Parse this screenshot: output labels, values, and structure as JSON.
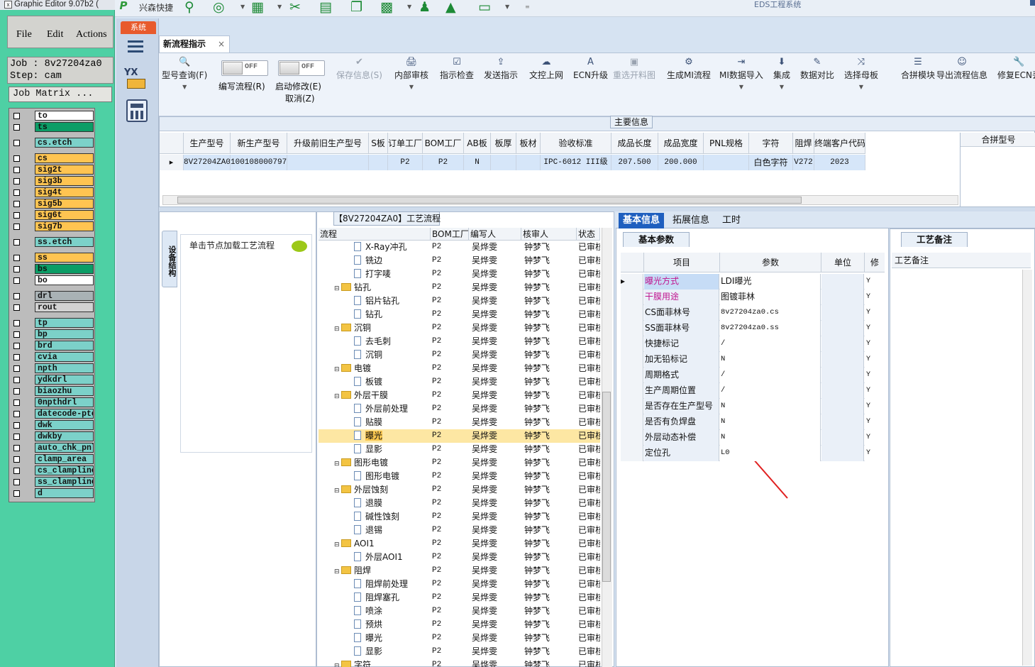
{
  "editor": {
    "title": "Graphic Editor 9.07b2 (",
    "menu": [
      "File",
      "Edit",
      "Actions"
    ],
    "job_line": "Job : 8v27204za0",
    "step_line": "Step: cam",
    "job_matrix": "Job Matrix ...",
    "layers": [
      {
        "name": "to",
        "color": "#ffffff"
      },
      {
        "name": "ts",
        "color": "#0c9d66"
      },
      {
        "name": "cs.etch",
        "color": "#7cd1c9"
      },
      {
        "name": "cs",
        "color": "#ffc451"
      },
      {
        "name": "sig2t",
        "color": "#ffc451"
      },
      {
        "name": "sig3b",
        "color": "#ffc451"
      },
      {
        "name": "sig4t",
        "color": "#ffc451"
      },
      {
        "name": "sig5b",
        "color": "#ffc451"
      },
      {
        "name": "sig6t",
        "color": "#ffc451"
      },
      {
        "name": "sig7b",
        "color": "#ffc451"
      },
      {
        "name": "ss.etch",
        "color": "#7cd1c9"
      },
      {
        "name": "ss",
        "color": "#ffc451"
      },
      {
        "name": "bs",
        "color": "#0c9d66"
      },
      {
        "name": "bo",
        "color": "#ffffff"
      },
      {
        "name": "drl",
        "color": "#a9b2b5"
      },
      {
        "name": "rout",
        "color": "#d2d2d2"
      },
      {
        "name": "tp",
        "color": "#7cd1c9"
      },
      {
        "name": "bp",
        "color": "#7cd1c9"
      },
      {
        "name": "brd",
        "color": "#7cd1c9"
      },
      {
        "name": "cvia",
        "color": "#7cd1c9"
      },
      {
        "name": "npth",
        "color": "#7cd1c9"
      },
      {
        "name": "ydkdrl",
        "color": "#7cd1c9"
      },
      {
        "name": "biaozhu",
        "color": "#7cd1c9"
      },
      {
        "name": "0npthdrl",
        "color": "#7cd1c9"
      },
      {
        "name": "datecode-pte",
        "color": "#7cd1c9"
      },
      {
        "name": "dwk",
        "color": "#7cd1c9"
      },
      {
        "name": "dwkby",
        "color": "#7cd1c9"
      },
      {
        "name": "auto_chk_pnl",
        "color": "#7cd1c9"
      },
      {
        "name": "clamp_area",
        "color": "#7cd1c9"
      },
      {
        "name": "cs_clampline",
        "color": "#7cd1c9"
      },
      {
        "name": "ss_clampline",
        "color": "#7cd1c9"
      },
      {
        "name": "d",
        "color": "#7cd1c9"
      }
    ]
  },
  "topbar": {
    "quick_label": "兴森快捷",
    "system_title": "EDS工程系统"
  },
  "leftnav": {
    "system_tab": "系统",
    "yx_label": "YX"
  },
  "doc_tab": {
    "label": "新流程指示",
    "close": "×"
  },
  "ribbon": {
    "toggle_text": "OFF",
    "buttons": [
      {
        "label": "型号查询(F)",
        "icon": "🔍"
      },
      {
        "label": "编写流程(R)"
      },
      {
        "label": "启动修改(E)",
        "label2": "取消(Z)"
      },
      {
        "label": "保存信息(S)",
        "icon": "✔",
        "disabled": true
      },
      {
        "label": "内部审核",
        "icon": "🖨"
      },
      {
        "label": "指示检查",
        "icon": "☑"
      },
      {
        "label": "发送指示",
        "icon": "⇪"
      },
      {
        "label": "文控上网",
        "icon": "☁"
      },
      {
        "label": "ECN升级",
        "icon": "A"
      },
      {
        "label": "重选开料图",
        "icon": "▣",
        "disabled": true
      },
      {
        "label": "生成MI流程",
        "icon": "⚙"
      },
      {
        "label": "MI数据导入",
        "icon": "⇥"
      },
      {
        "label": "集成",
        "icon": "⬇"
      },
      {
        "label": "数据对比",
        "icon": "✎"
      },
      {
        "label": "选择母板",
        "icon": "⤨"
      },
      {
        "label": "合拼模块",
        "icon": "☰"
      },
      {
        "label": "导出流程信息",
        "icon": "☺"
      },
      {
        "label": "修复ECN丢",
        "icon": "🔧"
      }
    ]
  },
  "main_info": {
    "title": "主要信息",
    "columns": [
      "生产型号",
      "新生产型号",
      "升级前旧生产型号",
      "S板",
      "订单工厂",
      "BOM工厂",
      "AB板",
      "板厚",
      "板材",
      "验收标准",
      "成品长度",
      "成品宽度",
      "PNL规格",
      "字符",
      "阻焊",
      "终端客户代码"
    ],
    "row": [
      "8V27204ZA0",
      "10010800079743",
      "",
      "",
      "P2",
      "P2",
      "N",
      "",
      "",
      "IPC-6012 III级",
      "207.500",
      "200.000",
      "",
      "白色字符",
      "V272",
      "2023"
    ],
    "right_header": "合拼型号"
  },
  "process": {
    "title": "【8V27204ZA0】工艺流程",
    "columns": [
      "流程",
      "BOM工厂",
      "编写人",
      "核审人",
      "状态"
    ],
    "editor": "吴烨雯",
    "reviewer": "钟梦飞",
    "status": "已审核",
    "bom": "P2",
    "rows": [
      {
        "name": "X-Ray冲孔",
        "level": 2,
        "sel": false
      },
      {
        "name": "铣边",
        "level": 2,
        "sel": false
      },
      {
        "name": "打字唛",
        "level": 2,
        "sel": false
      },
      {
        "name": "钻孔",
        "level": 1,
        "sel": false
      },
      {
        "name": "铝片钻孔",
        "level": 2,
        "sel": false
      },
      {
        "name": "钻孔",
        "level": 2,
        "sel": false
      },
      {
        "name": "沉铜",
        "level": 1,
        "sel": false
      },
      {
        "name": "去毛刺",
        "level": 2,
        "sel": false
      },
      {
        "name": "沉铜",
        "level": 2,
        "sel": false
      },
      {
        "name": "电镀",
        "level": 1,
        "sel": false
      },
      {
        "name": "板镀",
        "level": 2,
        "sel": false
      },
      {
        "name": "外层干膜",
        "level": 1,
        "sel": false
      },
      {
        "name": "外层前处理",
        "level": 2,
        "sel": false
      },
      {
        "name": "贴膜",
        "level": 2,
        "sel": false
      },
      {
        "name": "曝光",
        "level": 2,
        "sel": true
      },
      {
        "name": "显影",
        "level": 2,
        "sel": false
      },
      {
        "name": "图形电镀",
        "level": 1,
        "sel": false
      },
      {
        "name": "图形电镀",
        "level": 2,
        "sel": false
      },
      {
        "name": "外层蚀刻",
        "level": 1,
        "sel": false
      },
      {
        "name": "退膜",
        "level": 2,
        "sel": false
      },
      {
        "name": "碱性蚀刻",
        "level": 2,
        "sel": false
      },
      {
        "name": "退锡",
        "level": 2,
        "sel": false
      },
      {
        "name": "AOI1",
        "level": 1,
        "sel": false
      },
      {
        "name": "外层AOI1",
        "level": 2,
        "sel": false
      },
      {
        "name": "阻焊",
        "level": 1,
        "sel": false
      },
      {
        "name": "阻焊前处理",
        "level": 2,
        "sel": false
      },
      {
        "name": "阻焊塞孔",
        "level": 2,
        "sel": false
      },
      {
        "name": "喷涂",
        "level": 2,
        "sel": false
      },
      {
        "name": "预烘",
        "level": 2,
        "sel": false
      },
      {
        "name": "曝光",
        "level": 2,
        "sel": false
      },
      {
        "name": "显影",
        "level": 2,
        "sel": false
      },
      {
        "name": "字符",
        "level": 1,
        "sel": false
      }
    ]
  },
  "lower_left": {
    "vertical_tab": "设备结构",
    "hint": "单击节点加载工艺流程"
  },
  "tabs": [
    "基本信息",
    "拓展信息",
    "工时"
  ],
  "basic": {
    "subtab": "基本参数",
    "columns": [
      "项目",
      "参数",
      "单位",
      "修"
    ],
    "rows": [
      {
        "k": "曝光方式",
        "v": "LDI曝光",
        "m": "Y",
        "color": "#c0158f",
        "mono": false
      },
      {
        "k": "干膜用途",
        "v": "图镀菲林",
        "m": "Y",
        "color": "#c0158f",
        "mono": false
      },
      {
        "k": "CS面菲林号",
        "v": "8v27204za0.cs",
        "m": "Y",
        "color": "#111111",
        "mono": true
      },
      {
        "k": "SS面菲林号",
        "v": "8v27204za0.ss",
        "m": "Y",
        "color": "#111111",
        "mono": true
      },
      {
        "k": "快捷标记",
        "v": "/",
        "m": "Y",
        "color": "#111111",
        "mono": true
      },
      {
        "k": "加无铅标记",
        "v": "N",
        "m": "Y",
        "color": "#111111",
        "mono": true
      },
      {
        "k": "周期格式",
        "v": "/",
        "m": "Y",
        "color": "#111111",
        "mono": true
      },
      {
        "k": "生产周期位置",
        "v": "/",
        "m": "Y",
        "color": "#111111",
        "mono": true
      },
      {
        "k": "是否存在生产型号",
        "v": "N",
        "m": "Y",
        "color": "#111111",
        "mono": true
      },
      {
        "k": "是否有负焊盘",
        "v": "N",
        "m": "Y",
        "color": "#111111",
        "mono": true
      },
      {
        "k": "外层动态补偿",
        "v": "N",
        "m": "Y",
        "color": "#111111",
        "mono": true
      },
      {
        "k": "定位孔",
        "v": "L0",
        "m": "Y",
        "color": "#111111",
        "mono": true
      }
    ]
  },
  "craft": {
    "tab": "工艺备注",
    "header": "工艺备注"
  },
  "colors": {
    "accent": "#1f5fbf",
    "selection": "#fde7a3",
    "arrow": "#e02020"
  }
}
